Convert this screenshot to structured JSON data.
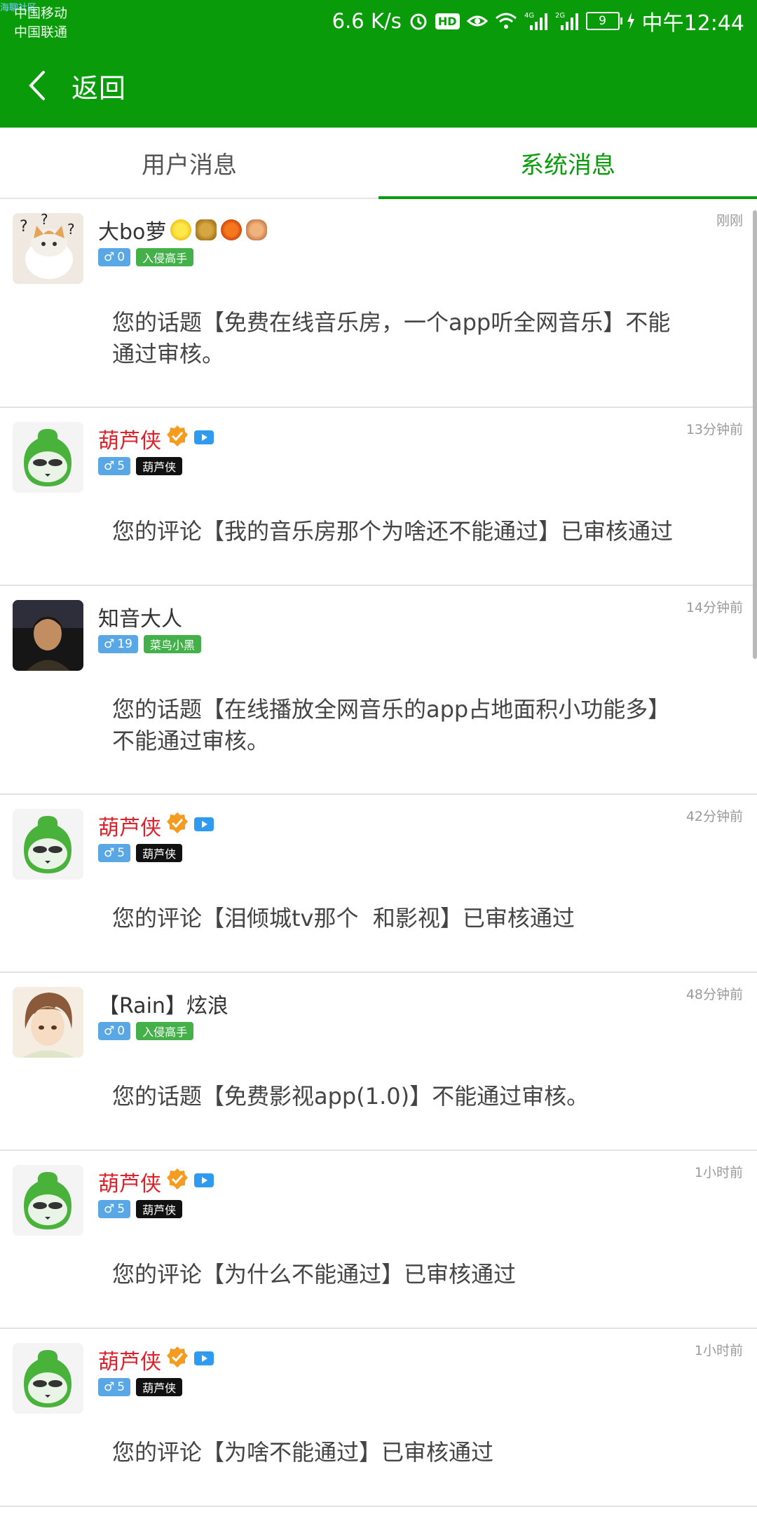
{
  "status": {
    "corner_tag": "海聊社区",
    "carrier1": "中国移动",
    "carrier2": "中国联通",
    "speed": "6.6 K/s",
    "hd": "HD",
    "net1": "4G",
    "net2": "2G",
    "battery": "9",
    "time": "中午12:44"
  },
  "nav": {
    "back_label": "返回"
  },
  "tabs": [
    {
      "label": "用户消息",
      "active": false
    },
    {
      "label": "系统消息",
      "active": true
    }
  ],
  "messages": [
    {
      "name": "大bo萝",
      "name_color": "dark",
      "time": "刚刚",
      "gender": "♂",
      "level": "0",
      "title": "入侵高手",
      "title_style": "green",
      "content_line1": "您的话题【免费在线音乐房，一个app听全网音乐】不能",
      "content_line2": "通过审核。",
      "avatar": "cat"
    },
    {
      "name": "葫芦侠",
      "name_color": "red",
      "time": "13分钟前",
      "gender": "♂",
      "level": "5",
      "title": "葫芦侠",
      "title_style": "black",
      "content_line1": "您的评论【我的音乐房那个为啥还不能通过】已审核通过",
      "content_line2": "",
      "avatar": "huluxia"
    },
    {
      "name": "知音大人",
      "name_color": "dark",
      "time": "14分钟前",
      "gender": "♂",
      "level": "19",
      "title": "菜鸟小黑",
      "title_style": "green",
      "content_line1": "您的话题【在线播放全网音乐的app占地面积小功能多】",
      "content_line2": "不能通过审核。",
      "avatar": "person"
    },
    {
      "name": "葫芦侠",
      "name_color": "red",
      "time": "42分钟前",
      "gender": "♂",
      "level": "5",
      "title": "葫芦侠",
      "title_style": "black",
      "content_line1": "您的评论【泪倾城tv那个  和影视】已审核通过",
      "content_line2": "",
      "avatar": "huluxia"
    },
    {
      "name": "【Rain】炫浪",
      "name_color": "dark",
      "time": "48分钟前",
      "gender": "♂",
      "level": "0",
      "title": "入侵高手",
      "title_style": "green",
      "content_line1": "您的话题【免费影视app(1.0)】不能通过审核。",
      "content_line2": "",
      "avatar": "anime"
    },
    {
      "name": "葫芦侠",
      "name_color": "red",
      "time": "1小时前",
      "gender": "♂",
      "level": "5",
      "title": "葫芦侠",
      "title_style": "black",
      "content_line1": "您的评论【为什么不能通过】已审核通过",
      "content_line2": "",
      "avatar": "huluxia"
    },
    {
      "name": "葫芦侠",
      "name_color": "red",
      "time": "1小时前",
      "gender": "♂",
      "level": "5",
      "title": "葫芦侠",
      "title_style": "black",
      "content_line1": "您的评论【为啥不能通过】已审核通过",
      "content_line2": "",
      "avatar": "huluxia"
    }
  ],
  "colors": {
    "brand_green": "#0a9b0b",
    "name_red": "#e0202a",
    "gender_blue": "#5aa7e6"
  }
}
